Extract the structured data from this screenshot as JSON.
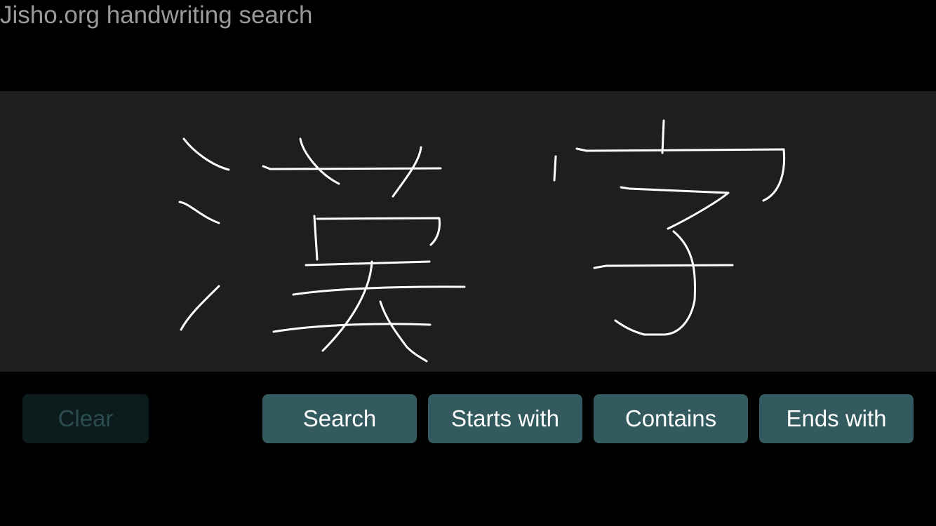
{
  "app": {
    "title": "Jisho.org handwriting search"
  },
  "drawing_area": {
    "handwritten_characters": [
      "漢",
      "字"
    ]
  },
  "buttons": {
    "clear": "Clear",
    "search": "Search",
    "starts_with": "Starts with",
    "contains": "Contains",
    "ends_with": "Ends with"
  },
  "colors": {
    "background": "#000000",
    "canvas": "#1e1e1e",
    "stroke": "#ffffff",
    "button": "#335a5e",
    "button_disabled": "#0c1b1c",
    "title_text": "#9a9a9a"
  }
}
